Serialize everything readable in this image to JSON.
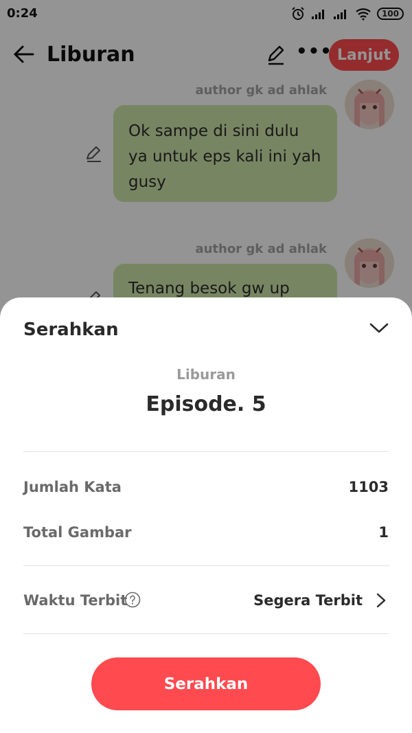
{
  "status_bar": {
    "time": "0:24",
    "battery": "100",
    "icons": [
      "alarm-icon",
      "signal-icon",
      "signal-icon",
      "wifi-icon",
      "battery-icon"
    ]
  },
  "app_bar": {
    "title": "Liburan",
    "next_label": "Lanjut",
    "icons": [
      "back-arrow-icon",
      "pencil-icon",
      "more-dots-icon"
    ],
    "more_glyph": "•••"
  },
  "chat": {
    "messages": [
      {
        "author": "author gk ad ahlak",
        "text": "Ok sampe di sini dulu ya untuk eps kali ini yah gusy"
      },
      {
        "author": "author gk ad ahlak",
        "text": "Tenang besok gw up"
      }
    ]
  },
  "sheet": {
    "title": "Serahkan",
    "story_title": "Liburan",
    "episode": "Episode. 5",
    "rows": [
      {
        "label": "Jumlah Kata",
        "value": "1103"
      },
      {
        "label": "Total Gambar",
        "value": "1"
      }
    ],
    "publish_time": {
      "label": "Waktu Terbit",
      "value": "Segera Terbit"
    },
    "submit_label": "Serahkan",
    "icons": [
      "chevron-down-icon",
      "help-circle-icon",
      "chevron-right-icon"
    ]
  },
  "colors": {
    "accent": "#ff4a4f",
    "bubble": "#cfe6a9",
    "scrim": "rgba(0,0,0,0.42)"
  }
}
